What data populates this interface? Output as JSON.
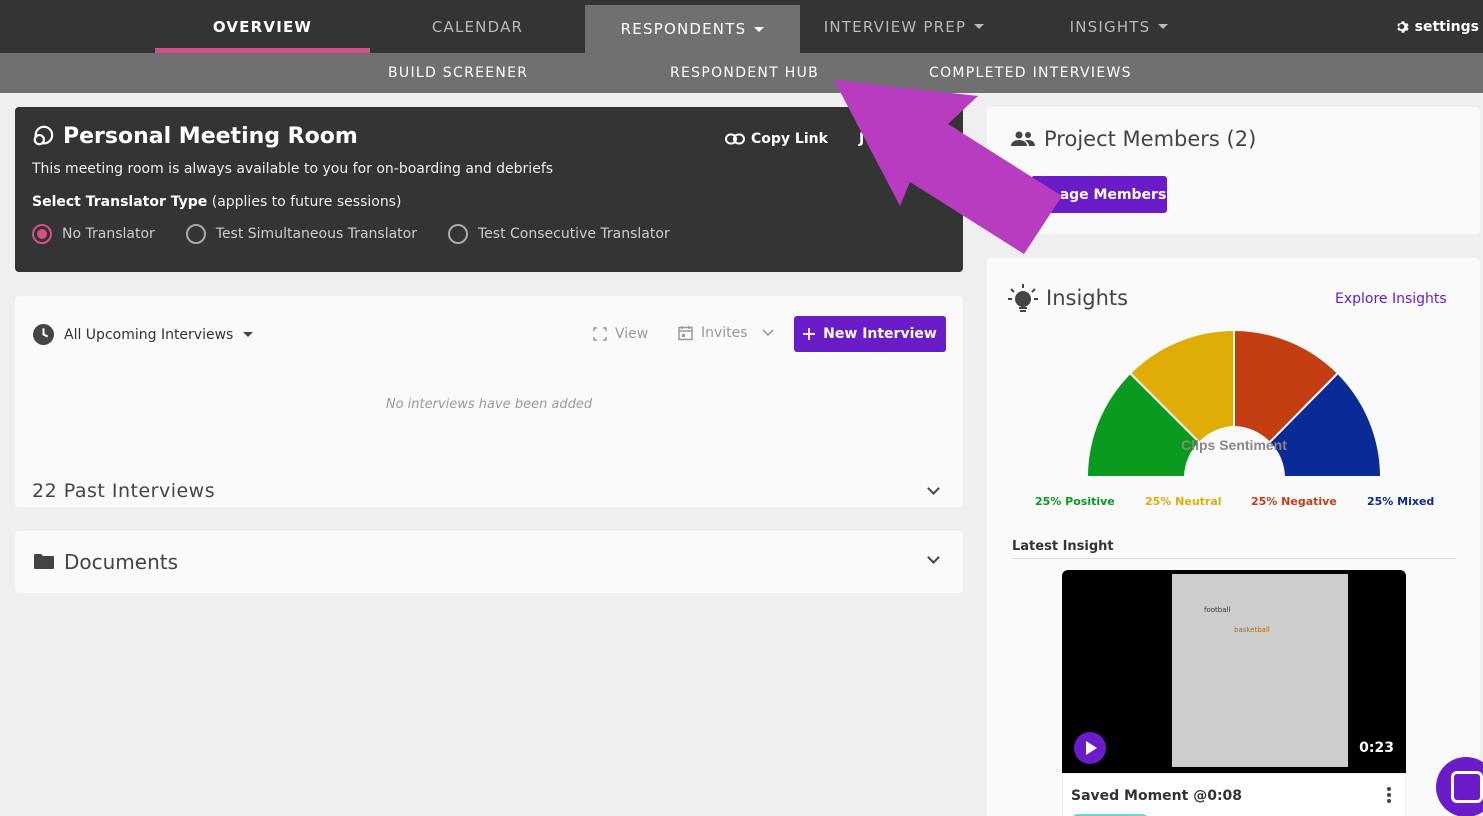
{
  "nav": {
    "tabs": [
      {
        "label": "OVERVIEW",
        "active": true
      },
      {
        "label": "CALENDAR"
      },
      {
        "label": "RESPONDENTS",
        "dropdown": true,
        "open": true
      },
      {
        "label": "INTERVIEW PREP",
        "dropdown": true
      },
      {
        "label": "INSIGHTS",
        "dropdown": true
      }
    ],
    "settings_label": "settings"
  },
  "subnav": {
    "items": [
      "BUILD SCREENER",
      "RESPONDENT HUB",
      "COMPLETED INTERVIEWS"
    ]
  },
  "meeting_room": {
    "title": "Personal Meeting Room",
    "copy_link_label": "Copy Link",
    "join_label": "J",
    "description": "This meeting room is always available to you for on-boarding and debriefs",
    "translator_label_bold": "Select Translator Type",
    "translator_label_rest": " (applies to future sessions)",
    "translator_options": [
      "No Translator",
      "Test Simultaneous Translator",
      "Test Consecutive Translator"
    ],
    "translator_selected": "No Translator"
  },
  "interviews": {
    "filter_label": "All Upcoming Interviews",
    "view_label": "View",
    "invites_label": "Invites",
    "new_interview_label": "New Interview",
    "empty_message": "No interviews have been added",
    "past_label": "22 Past Interviews"
  },
  "documents": {
    "title": "Documents"
  },
  "project_members": {
    "title": "Project Members (2)",
    "manage_label": "age Members"
  },
  "insights": {
    "title": "Insights",
    "explore_label": "Explore Insights",
    "gauge_label": "Clips Sentiment",
    "legend": [
      {
        "label": "25% Positive",
        "color": "#0a9a1e"
      },
      {
        "label": "25% Neutral",
        "color": "#e0ad07"
      },
      {
        "label": "25% Negative",
        "color": "#c43e14"
      },
      {
        "label": "25% Mixed",
        "color": "#0a2a96"
      }
    ],
    "latest_label": "Latest Insight",
    "video": {
      "words": [
        "football",
        "basketball"
      ],
      "duration": "0:23"
    },
    "moment_label": "Saved Moment @0:08"
  },
  "colors": {
    "accent": "#6a1cc9",
    "active_underline": "#d4508a",
    "arrow": "#b73cbf"
  }
}
